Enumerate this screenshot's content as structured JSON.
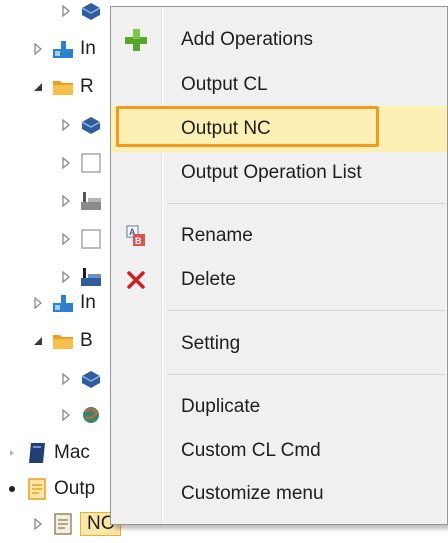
{
  "tree": {
    "labels": [
      "In",
      "R",
      "In",
      "B",
      "Mac",
      "Outp",
      "NC"
    ]
  },
  "menu": {
    "items": [
      {
        "label": "Add Operations",
        "icon": "plus-icon"
      },
      {
        "label": "Output CL",
        "icon": ""
      },
      {
        "label": "Output NC",
        "icon": "",
        "highlighted": true
      },
      {
        "label": "Output Operation List",
        "icon": ""
      },
      {
        "label": "Rename",
        "icon": "rename-icon"
      },
      {
        "label": "Delete",
        "icon": "delete-x-icon"
      },
      {
        "label": "Setting",
        "icon": ""
      },
      {
        "label": "Duplicate",
        "icon": ""
      },
      {
        "label": "Custom CL Cmd",
        "icon": ""
      },
      {
        "label": "Customize menu",
        "icon": ""
      }
    ]
  },
  "colors": {
    "menu_bg": "#f0f0f0",
    "highlight_bg": "#fdf0b4",
    "highlight_border": "#f39a1e",
    "plus_green": "#58a52d",
    "delete_red": "#d32020",
    "folder_orange": "#e8a020"
  }
}
